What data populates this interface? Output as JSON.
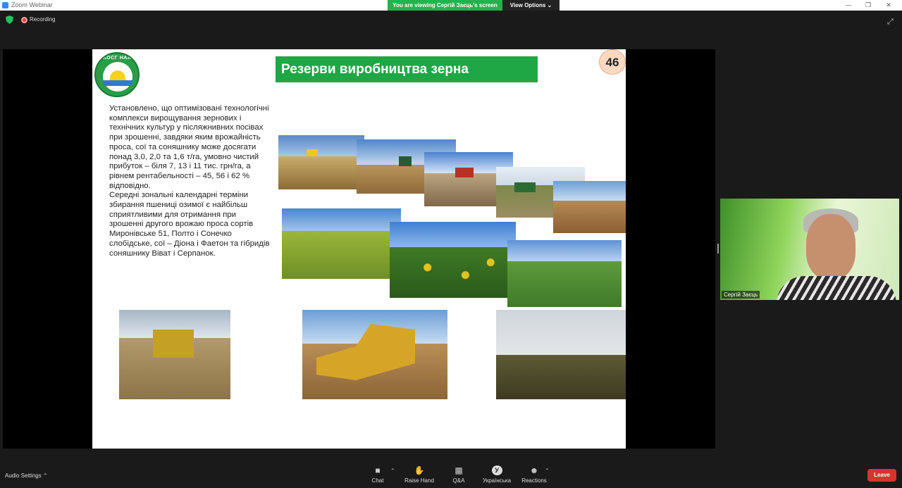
{
  "window": {
    "title": "Zoom Webinar",
    "viewing_banner": "You are viewing Сергій Заєць's screen",
    "view_options": "View Options",
    "recording_label": "Recording"
  },
  "slide": {
    "title": "Резерви виробництва зерна",
    "page_number": "46",
    "logo_text": "ІКОСГ НААН",
    "paragraph_1": " Установлено, що оптимізовані технологічні комплекси вирощування зернових і технічних культур у післяжнивних посівах при зрошенні, завдяки яким врожайність проса, сої та соняшнику може досягати понад 3,0, 2,0 та 1,6 т/га, умовно чистий прибуток – біля 7, 13 і 11 тис. грн/га, а рівнем рентабельності –  45, 56 і 62 % відповідно.",
    "paragraph_2": "Середні зональні календарні терміни збирання пшениці озимої є найбільш сприятливими для отримання при зрошенні другого врожаю проса сортів Миронівське 51, Полто і Сонечко слобідське, сої – Діона і Фаетон та гібридів соняшнику Віват і Серпанок."
  },
  "video": {
    "participant_name": "Сергій Заєць"
  },
  "toolbar": {
    "audio_settings": "Audio Settings",
    "chat": "Chat",
    "raise_hand": "Raise Hand",
    "qa": "Q&A",
    "language": "Українська",
    "language_icon_letter": "У",
    "reactions": "Reactions",
    "leave": "Leave"
  },
  "colors": {
    "zoom_green": "#24b24d",
    "slide_title_bg": "#1fa645",
    "leave_red": "#d8342b",
    "recording_red": "#e0443a"
  }
}
